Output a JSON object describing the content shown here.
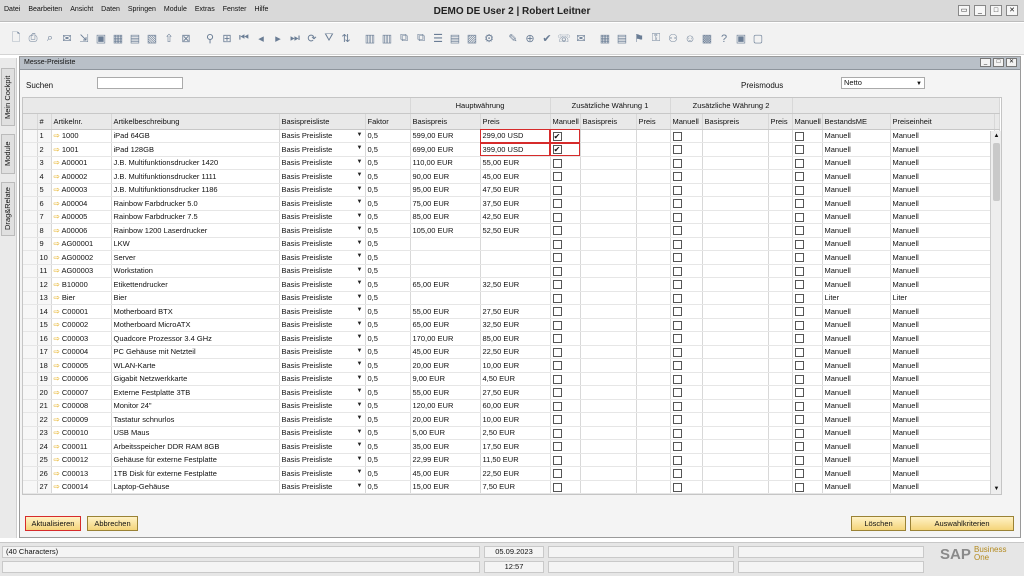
{
  "menu": [
    "Datei",
    "Bearbeiten",
    "Ansicht",
    "Daten",
    "Springen",
    "Module",
    "Extras",
    "Fenster",
    "Hilfe"
  ],
  "app_title": "DEMO DE User 2 | Robert Leitner",
  "side_tabs": [
    "Mein Cockpit",
    "Module",
    "Drag&Relate"
  ],
  "window": {
    "title": "Messe-Preisliste"
  },
  "search": {
    "label": "Suchen",
    "value": ""
  },
  "price_mode": {
    "label": "Preismodus",
    "value": "Netto"
  },
  "groups": {
    "main": "Hauptwährung",
    "add1": "Zusätzliche Währung 1",
    "add2": "Zusätzliche Währung 2"
  },
  "columns": {
    "num": "#",
    "item": "Artikelnr.",
    "desc": "Artikelbeschreibung",
    "base_list": "Basispreisliste",
    "factor": "Faktor",
    "base_price": "Basispreis",
    "price": "Preis",
    "manual": "Manuell",
    "add1_base": "Basispreis",
    "add1_price": "Preis",
    "add1_manual": "Manuell",
    "add2_base": "Basispreis",
    "add2_price": "Preis",
    "add2_manual": "Manuell",
    "stock_uom": "BestandsME",
    "price_unit": "Preiseinheit"
  },
  "rows": [
    {
      "n": "1",
      "item": "1000",
      "desc": "iPad 64GB",
      "list": "Basis Preisliste",
      "factor": "0,5",
      "base": "599,00 EUR",
      "price": "299,00 USD",
      "manual": true,
      "uom": "Manuell",
      "unit": "Manuell"
    },
    {
      "n": "2",
      "item": "1001",
      "desc": "iPad 128GB",
      "list": "Basis Preisliste",
      "factor": "0,5",
      "base": "699,00 EUR",
      "price": "399,00 USD",
      "manual": true,
      "uom": "Manuell",
      "unit": "Manuell"
    },
    {
      "n": "3",
      "item": "A00001",
      "desc": "J.B. Multifunktionsdrucker 1420",
      "list": "Basis Preisliste",
      "factor": "0,5",
      "base": "110,00 EUR",
      "price": "55,00 EUR",
      "manual": false,
      "uom": "Manuell",
      "unit": "Manuell"
    },
    {
      "n": "4",
      "item": "A00002",
      "desc": "J.B. Multifunktionsdrucker 1111",
      "list": "Basis Preisliste",
      "factor": "0,5",
      "base": "90,00 EUR",
      "price": "45,00 EUR",
      "manual": false,
      "uom": "Manuell",
      "unit": "Manuell"
    },
    {
      "n": "5",
      "item": "A00003",
      "desc": "J.B. Multifunktionsdrucker 1186",
      "list": "Basis Preisliste",
      "factor": "0,5",
      "base": "95,00 EUR",
      "price": "47,50 EUR",
      "manual": false,
      "uom": "Manuell",
      "unit": "Manuell"
    },
    {
      "n": "6",
      "item": "A00004",
      "desc": "Rainbow Farbdrucker 5.0",
      "list": "Basis Preisliste",
      "factor": "0,5",
      "base": "75,00 EUR",
      "price": "37,50 EUR",
      "manual": false,
      "uom": "Manuell",
      "unit": "Manuell"
    },
    {
      "n": "7",
      "item": "A00005",
      "desc": "Rainbow Farbdrucker 7.5",
      "list": "Basis Preisliste",
      "factor": "0,5",
      "base": "85,00 EUR",
      "price": "42,50 EUR",
      "manual": false,
      "uom": "Manuell",
      "unit": "Manuell"
    },
    {
      "n": "8",
      "item": "A00006",
      "desc": "Rainbow 1200 Laserdrucker",
      "list": "Basis Preisliste",
      "factor": "0,5",
      "base": "105,00 EUR",
      "price": "52,50 EUR",
      "manual": false,
      "uom": "Manuell",
      "unit": "Manuell"
    },
    {
      "n": "9",
      "item": "AG00001",
      "desc": "LKW",
      "list": "Basis Preisliste",
      "factor": "0,5",
      "base": "",
      "price": "",
      "manual": false,
      "uom": "Manuell",
      "unit": "Manuell"
    },
    {
      "n": "10",
      "item": "AG00002",
      "desc": "Server",
      "list": "Basis Preisliste",
      "factor": "0,5",
      "base": "",
      "price": "",
      "manual": false,
      "uom": "Manuell",
      "unit": "Manuell"
    },
    {
      "n": "11",
      "item": "AG00003",
      "desc": "Workstation",
      "list": "Basis Preisliste",
      "factor": "0,5",
      "base": "",
      "price": "",
      "manual": false,
      "uom": "Manuell",
      "unit": "Manuell"
    },
    {
      "n": "12",
      "item": "B10000",
      "desc": "Etikettendrucker",
      "list": "Basis Preisliste",
      "factor": "0,5",
      "base": "65,00 EUR",
      "price": "32,50 EUR",
      "manual": false,
      "uom": "Manuell",
      "unit": "Manuell"
    },
    {
      "n": "13",
      "item": "Bier",
      "desc": "Bier",
      "list": "Basis Preisliste",
      "factor": "0,5",
      "base": "",
      "price": "",
      "manual": false,
      "uom": "Liter",
      "unit": "Liter"
    },
    {
      "n": "14",
      "item": "C00001",
      "desc": "Motherboard BTX",
      "list": "Basis Preisliste",
      "factor": "0,5",
      "base": "55,00 EUR",
      "price": "27,50 EUR",
      "manual": false,
      "uom": "Manuell",
      "unit": "Manuell"
    },
    {
      "n": "15",
      "item": "C00002",
      "desc": "Motherboard MicroATX",
      "list": "Basis Preisliste",
      "factor": "0,5",
      "base": "65,00 EUR",
      "price": "32,50 EUR",
      "manual": false,
      "uom": "Manuell",
      "unit": "Manuell"
    },
    {
      "n": "16",
      "item": "C00003",
      "desc": "Quadcore Prozessor 3.4 GHz",
      "list": "Basis Preisliste",
      "factor": "0,5",
      "base": "170,00 EUR",
      "price": "85,00 EUR",
      "manual": false,
      "uom": "Manuell",
      "unit": "Manuell"
    },
    {
      "n": "17",
      "item": "C00004",
      "desc": "PC Gehäuse mit Netzteil",
      "list": "Basis Preisliste",
      "factor": "0,5",
      "base": "45,00 EUR",
      "price": "22,50 EUR",
      "manual": false,
      "uom": "Manuell",
      "unit": "Manuell"
    },
    {
      "n": "18",
      "item": "C00005",
      "desc": "WLAN-Karte",
      "list": "Basis Preisliste",
      "factor": "0,5",
      "base": "20,00 EUR",
      "price": "10,00 EUR",
      "manual": false,
      "uom": "Manuell",
      "unit": "Manuell"
    },
    {
      "n": "19",
      "item": "C00006",
      "desc": "Gigabit Netzwerkkarte",
      "list": "Basis Preisliste",
      "factor": "0,5",
      "base": "9,00 EUR",
      "price": "4,50 EUR",
      "manual": false,
      "uom": "Manuell",
      "unit": "Manuell"
    },
    {
      "n": "20",
      "item": "C00007",
      "desc": "Externe Festplatte 3TB",
      "list": "Basis Preisliste",
      "factor": "0,5",
      "base": "55,00 EUR",
      "price": "27,50 EUR",
      "manual": false,
      "uom": "Manuell",
      "unit": "Manuell"
    },
    {
      "n": "21",
      "item": "C00008",
      "desc": "Monitor 24\"",
      "list": "Basis Preisliste",
      "factor": "0,5",
      "base": "120,00 EUR",
      "price": "60,00 EUR",
      "manual": false,
      "uom": "Manuell",
      "unit": "Manuell"
    },
    {
      "n": "22",
      "item": "C00009",
      "desc": "Tastatur schnurlos",
      "list": "Basis Preisliste",
      "factor": "0,5",
      "base": "20,00 EUR",
      "price": "10,00 EUR",
      "manual": false,
      "uom": "Manuell",
      "unit": "Manuell"
    },
    {
      "n": "23",
      "item": "C00010",
      "desc": "USB Maus",
      "list": "Basis Preisliste",
      "factor": "0,5",
      "base": "5,00 EUR",
      "price": "2,50 EUR",
      "manual": false,
      "uom": "Manuell",
      "unit": "Manuell"
    },
    {
      "n": "24",
      "item": "C00011",
      "desc": "Arbeitsspeicher DDR RAM 8GB",
      "list": "Basis Preisliste",
      "factor": "0,5",
      "base": "35,00 EUR",
      "price": "17,50 EUR",
      "manual": false,
      "uom": "Manuell",
      "unit": "Manuell"
    },
    {
      "n": "25",
      "item": "C00012",
      "desc": "Gehäuse für externe Festplatte",
      "list": "Basis Preisliste",
      "factor": "0,5",
      "base": "22,99 EUR",
      "price": "11,50 EUR",
      "manual": false,
      "uom": "Manuell",
      "unit": "Manuell"
    },
    {
      "n": "26",
      "item": "C00013",
      "desc": "1TB Disk für externe Festplatte",
      "list": "Basis Preisliste",
      "factor": "0,5",
      "base": "45,00 EUR",
      "price": "22,50 EUR",
      "manual": false,
      "uom": "Manuell",
      "unit": "Manuell"
    },
    {
      "n": "27",
      "item": "C00014",
      "desc": "Laptop-Gehäuse",
      "list": "Basis Preisliste",
      "factor": "0,5",
      "base": "15,00 EUR",
      "price": "7,50 EUR",
      "manual": false,
      "uom": "Manuell",
      "unit": "Manuell"
    }
  ],
  "buttons": {
    "update": "Aktualisieren",
    "cancel": "Abbrechen",
    "delete": "Löschen",
    "criteria": "Auswahlkriterien"
  },
  "status": {
    "message": "(40 Characters)",
    "date": "05.09.2023",
    "time": "12:57"
  },
  "logo": {
    "sap": "SAP",
    "business_one": "Business One"
  },
  "colors": {
    "button": "#f4d479",
    "highlight": "#d62b2b",
    "arrow": "#e2a500"
  }
}
